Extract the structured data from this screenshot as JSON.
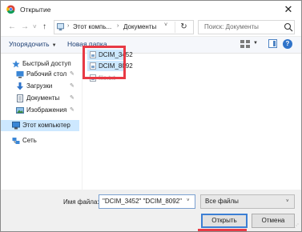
{
  "window": {
    "title": "Открытие",
    "close_glyph": "✕",
    "app_icon": "chrome-icon"
  },
  "navigation": {
    "back_glyph": "←",
    "forward_glyph": "→",
    "recent_glyph": "˅",
    "up_glyph": "↑",
    "breadcrumbs": [
      "Этот компь...",
      "Документы"
    ],
    "separator_glyph": "›",
    "dropdown_glyph": "˅",
    "refresh_glyph": "↻",
    "search_placeholder": "Поиск: Документы"
  },
  "toolbar": {
    "organize_label": "Упорядочить",
    "organize_caret": "▼",
    "new_folder_label": "Новая папка",
    "views_caret": "▼",
    "help_label": "?"
  },
  "sidebar": {
    "pin_glyph": "✎",
    "items": [
      {
        "label": "Быстрый доступ",
        "icon": "star-icon",
        "pinned": false
      },
      {
        "label": "Рабочий стол",
        "icon": "desktop-icon",
        "pinned": true
      },
      {
        "label": "Загрузки",
        "icon": "download-icon",
        "pinned": true
      },
      {
        "label": "Документы",
        "icon": "document-icon",
        "pinned": true
      },
      {
        "label": "Изображения",
        "icon": "pictures-icon",
        "pinned": true
      },
      {
        "label": "Этот компьютер",
        "icon": "computer-icon",
        "selected": true
      },
      {
        "label": "Сеть",
        "icon": "network-icon"
      }
    ]
  },
  "files": [
    {
      "name": "DCIM_3452",
      "selected": true
    },
    {
      "name": "DCIM_8092",
      "selected": true
    },
    {
      "name": "file.txt",
      "faded": true
    }
  ],
  "bottom": {
    "filename_label": "Имя файла:",
    "filename_value": "\"DCIM_3452\" \"DCIM_8092\"",
    "filename_dropdown": "˅",
    "filter_value": "Все файлы",
    "filter_dropdown": "˅",
    "open_label": "Открыть",
    "cancel_label": "Отмена",
    "grip_glyph": "⋰"
  },
  "colors": {
    "accent": "#3c7fd4",
    "selection": "#cce8ff",
    "annotation": "#e83a45",
    "link": "#1d3f73"
  }
}
